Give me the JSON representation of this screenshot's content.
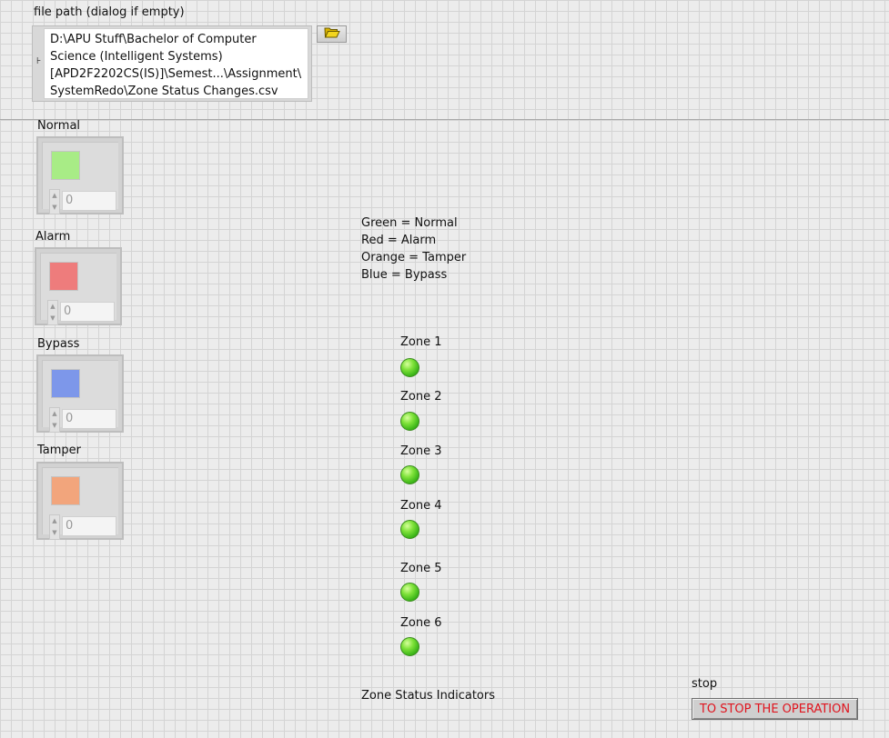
{
  "file_path": {
    "label": "file path (dialog if empty)",
    "value": "D:\\APU Stuff\\Bachelor of Computer\nScience (Intelligent Systems)\n[APD2F2202CS(IS)]\\Semest...\\Assignment\\\nSystemRedo\\Zone Status Changes.csv",
    "browse_icon": "folder-open-icon"
  },
  "color_controls": [
    {
      "label": "Normal",
      "color": "#a8ec86",
      "value": "0"
    },
    {
      "label": "Alarm",
      "color": "#ee7c7c",
      "value": "0"
    },
    {
      "label": "Bypass",
      "color": "#7d97ea",
      "value": "0"
    },
    {
      "label": "Tamper",
      "color": "#f2a57c",
      "value": "0"
    }
  ],
  "legend": "Green = Normal\nRed = Alarm\nOrange = Tamper\nBlue = Bypass",
  "zones": [
    {
      "label": "Zone 1",
      "color": "green"
    },
    {
      "label": "Zone 2",
      "color": "green"
    },
    {
      "label": "Zone 3",
      "color": "green"
    },
    {
      "label": "Zone 4",
      "color": "green"
    },
    {
      "label": "Zone 5",
      "color": "green"
    },
    {
      "label": "Zone 6",
      "color": "green"
    }
  ],
  "zone_caption": "Zone Status Indicators",
  "stop": {
    "label": "stop",
    "button_text": "TO STOP THE OPERATION",
    "text_color": "#e0141e"
  }
}
